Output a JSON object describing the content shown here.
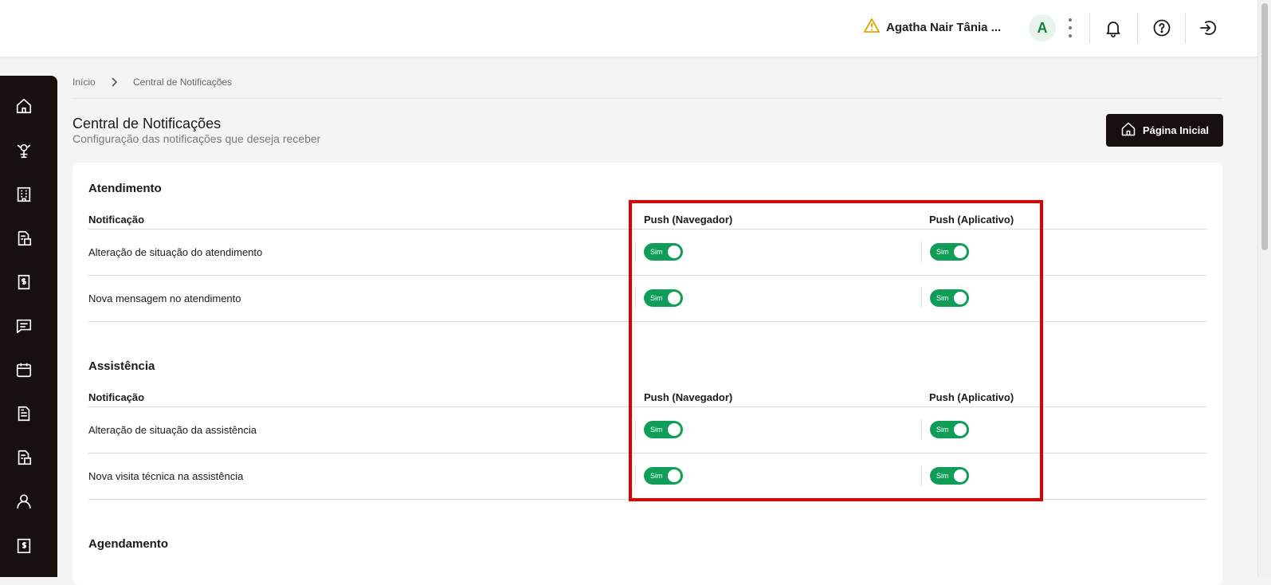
{
  "header": {
    "user_name": "Agatha Nair Tânia ...",
    "avatar_letter": "A",
    "icons": [
      "warning-icon",
      "more-vertical-icon",
      "bell-icon",
      "help-icon",
      "logout-icon"
    ]
  },
  "sidebar": {
    "icons": [
      "home-icon",
      "unit-icon",
      "building-icon",
      "document-building-icon",
      "finance-document-icon",
      "chat-icon",
      "calendar-icon",
      "document-icon",
      "document-building-icon",
      "user-icon",
      "finance-building-icon"
    ]
  },
  "breadcrumb": {
    "home": "Início",
    "current": "Central de Notificações"
  },
  "page": {
    "title": "Central de Notificações",
    "subtitle": "Configuração das notificações que deseja receber",
    "home_button": "Página Inicial"
  },
  "sections": [
    {
      "title": "Atendimento",
      "col_notification": "Notificação",
      "col_browser": "Push (Navegador)",
      "col_app": "Push (Aplicativo)",
      "rows": [
        {
          "label": "Alteração de situação do atendimento",
          "browser": "Sim",
          "app": "Sim"
        },
        {
          "label": "Nova mensagem no atendimento",
          "browser": "Sim",
          "app": "Sim"
        }
      ]
    },
    {
      "title": "Assistência",
      "col_notification": "Notificação",
      "col_browser": "Push (Navegador)",
      "col_app": "Push (Aplicativo)",
      "rows": [
        {
          "label": "Alteração de situação da assistência",
          "browser": "Sim",
          "app": "Sim"
        },
        {
          "label": "Nova visita técnica na assistência",
          "browser": "Sim",
          "app": "Sim"
        }
      ]
    },
    {
      "title": "Agendamento"
    }
  ],
  "colors": {
    "accent": "#0f9d58",
    "dark": "#17100f",
    "highlight": "#e00000",
    "warning": "#e0a800"
  }
}
